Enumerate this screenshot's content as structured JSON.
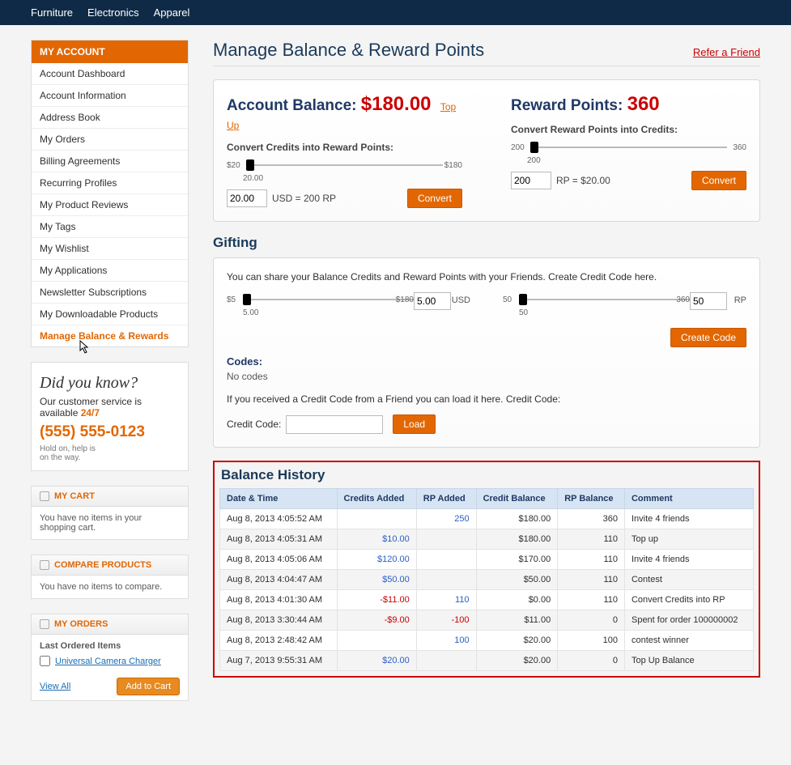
{
  "topnav": [
    "Furniture",
    "Electronics",
    "Apparel"
  ],
  "sidebar": {
    "title": "MY ACCOUNT",
    "items": [
      "Account Dashboard",
      "Account Information",
      "Address Book",
      "My Orders",
      "Billing Agreements",
      "Recurring Profiles",
      "My Product Reviews",
      "My Tags",
      "My Wishlist",
      "My Applications",
      "Newsletter Subscriptions",
      "My Downloadable Products",
      "Manage Balance & Rewards"
    ],
    "active_index": 12
  },
  "promo": {
    "headline": "Did you know?",
    "line1": "Our customer service is",
    "line2": "available ",
    "accent": "24/7",
    "phone": "(555) 555-0123",
    "small1": "Hold on, help is",
    "small2": "on the way."
  },
  "cart": {
    "title": "MY CART",
    "empty": "You have no items in your shopping cart."
  },
  "compare": {
    "title": "COMPARE PRODUCTS",
    "empty": "You have no items to compare."
  },
  "orders": {
    "title": "MY ORDERS",
    "last_label": "Last Ordered Items",
    "item": "Universal Camera Charger",
    "viewall": "View All",
    "addtocart": "Add to Cart"
  },
  "page_title": "Manage Balance & Reward Points",
  "refer": "Refer a Friend",
  "balance": {
    "label": "Account Balance:",
    "value": "$180.00",
    "topup": "Top Up",
    "convert_label": "Convert Credits into Reward Points:",
    "min": "$20",
    "max": "$180",
    "cur": "20.00",
    "input": "20.00",
    "eq": "USD = 200 RP",
    "btn": "Convert"
  },
  "rewards": {
    "label": "Reward Points:",
    "value": "360",
    "convert_label": "Convert Reward Points into Credits:",
    "min": "200",
    "max": "360",
    "cur": "200",
    "input": "200",
    "eq": "RP = $20.00",
    "btn": "Convert"
  },
  "gifting": {
    "title": "Gifting",
    "intro": "You can share your Balance Credits and Reward Points with your Friends. Create Credit Code here.",
    "s1_min": "$5",
    "s1_max": "$180",
    "s1_cur": "5.00",
    "s1_input": "5.00",
    "s1_unit": "USD",
    "s2_min": "50",
    "s2_max": "360",
    "s2_cur": "50",
    "s2_input": "50",
    "s2_unit": "RP",
    "create": "Create Code",
    "codes_label": "Codes:",
    "nocodes": "No codes",
    "receive": "If you received a Credit Code from a Friend you can load it here. Credit Code:",
    "input_label": "Credit Code:",
    "load": "Load"
  },
  "history": {
    "title": "Balance History",
    "cols": [
      "Date & Time",
      "Credits Added",
      "RP Added",
      "Credit Balance",
      "RP Balance",
      "Comment"
    ],
    "rows": [
      {
        "dt": "Aug 8, 2013 4:05:52 AM",
        "ca": "",
        "rp": "250",
        "cb": "$180.00",
        "rb": "360",
        "c": "Invite 4 friends"
      },
      {
        "dt": "Aug 8, 2013 4:05:31 AM",
        "ca": "$10.00",
        "rp": "",
        "cb": "$180.00",
        "rb": "110",
        "c": "Top up"
      },
      {
        "dt": "Aug 8, 2013 4:05:06 AM",
        "ca": "$120.00",
        "rp": "",
        "cb": "$170.00",
        "rb": "110",
        "c": "Invite 4 friends"
      },
      {
        "dt": "Aug 8, 2013 4:04:47 AM",
        "ca": "$50.00",
        "rp": "",
        "cb": "$50.00",
        "rb": "110",
        "c": "Contest"
      },
      {
        "dt": "Aug 8, 2013 4:01:30 AM",
        "ca": "-$11.00",
        "rp": "110",
        "cb": "$0.00",
        "rb": "110",
        "c": "Convert Credits into RP"
      },
      {
        "dt": "Aug 8, 2013 3:30:44 AM",
        "ca": "-$9.00",
        "rp": "-100",
        "cb": "$11.00",
        "rb": "0",
        "c": "Spent for order 100000002"
      },
      {
        "dt": "Aug 8, 2013 2:48:42 AM",
        "ca": "",
        "rp": "100",
        "cb": "$20.00",
        "rb": "100",
        "c": "contest winner"
      },
      {
        "dt": "Aug 7, 2013 9:55:31 AM",
        "ca": "$20.00",
        "rp": "",
        "cb": "$20.00",
        "rb": "0",
        "c": "Top Up Balance"
      }
    ]
  }
}
